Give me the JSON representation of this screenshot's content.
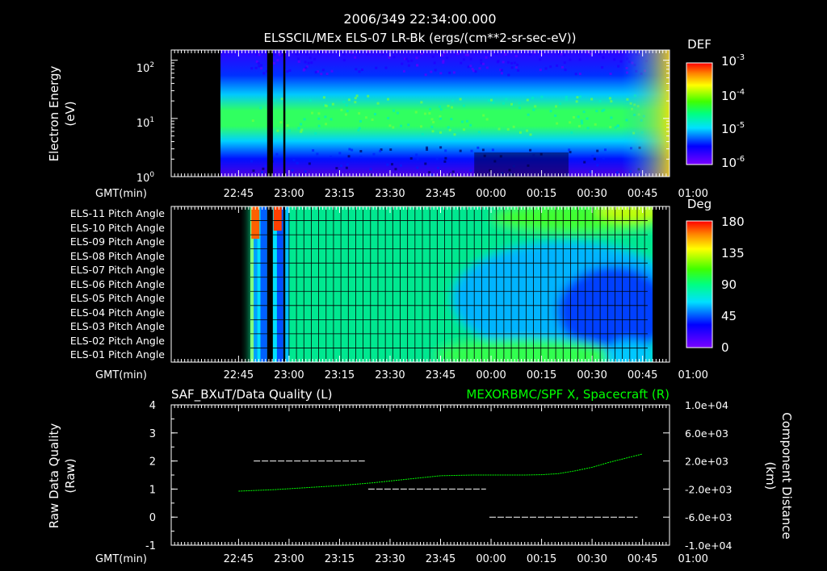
{
  "header": {
    "timestamp": "2006/349 22:34:00.000",
    "subtitle": "ELSSCIL/MEx ELS-07 LR-Bk  (ergs/(cm**2-sr-sec-eV))"
  },
  "time_axis": {
    "label": "GMT(min)",
    "ticks": [
      "22:45",
      "23:00",
      "23:15",
      "23:30",
      "23:45",
      "00:00",
      "00:15",
      "00:30",
      "00:45",
      "01:00"
    ]
  },
  "chart_data": [
    {
      "type": "heatmap",
      "name": "energy-spectrogram",
      "ylabel_line1": "Electron Energy",
      "ylabel_line2": "(eV)",
      "y_scale": "log",
      "ylim": [
        1,
        150
      ],
      "y_ticks": [
        "10",
        "10",
        "10"
      ],
      "y_tick_exponents": [
        "0",
        "1",
        "2"
      ],
      "x_range_min": [
        -20,
        128
      ],
      "x_ticks_min": [
        0,
        15,
        30,
        45,
        60,
        75,
        90,
        105,
        120,
        135
      ],
      "data_start_min": 3.5,
      "gaps_min": [
        [
          8.5,
          10.2
        ],
        [
          13.3,
          13.9
        ]
      ],
      "colorbar": {
        "title": "DEF",
        "labels": [
          "10",
          "10",
          "10",
          "10"
        ],
        "exponents": [
          "-3",
          "-4",
          "-5",
          "-6"
        ],
        "values": [
          0.001,
          0.0001,
          1e-05,
          1e-06
        ]
      }
    },
    {
      "type": "heatmap",
      "name": "pitch-angle",
      "rows": [
        "ELS-11 Pitch Angle",
        "ELS-10 Pitch Angle",
        "ELS-09 Pitch Angle",
        "ELS-08 Pitch Angle",
        "ELS-07 Pitch Angle",
        "ELS-06 Pitch Angle",
        "ELS-05 Pitch Angle",
        "ELS-04 Pitch Angle",
        "ELS-03 Pitch Angle",
        "ELS-02 Pitch Angle",
        "ELS-01 Pitch Angle"
      ],
      "data_start_min": 3.5,
      "data_end_min": 121.5,
      "grid": true,
      "colorbar": {
        "title": "Deg",
        "labels": [
          "180",
          "135",
          "90",
          "45",
          "0"
        ],
        "values": [
          180,
          135,
          90,
          45,
          0
        ]
      }
    },
    {
      "type": "line",
      "name": "quality-and-distance",
      "title_left": "SAF_BXuT/Data Quality (L)",
      "title_right": "MEXORBMC/SPF X, Spacecraft (R)",
      "left_axis": {
        "label_line1": "Raw Data Quality",
        "label_line2": "(Raw)",
        "ylim": [
          -1,
          4
        ],
        "ticks": [
          "-1",
          "0",
          "1",
          "2",
          "3",
          "4"
        ]
      },
      "right_axis": {
        "label_line1": "Component Distance",
        "label_line2": "(km)",
        "ylim": [
          -10000,
          10000
        ],
        "ticks": [
          "1.0e+04",
          "6.0e+03",
          "2.0e+03",
          "-2.0e+03",
          "-6.0e+03",
          "-1.0e+04"
        ],
        "tick_values": [
          10000,
          6000,
          2000,
          -2000,
          -6000,
          -10000
        ]
      },
      "series": [
        {
          "name": "SAF_BXuT/Data Quality (L)",
          "axis": "left",
          "color": "#ffffff",
          "style": "dashed",
          "segments": [
            {
              "x": [
                4.5,
                37.5
              ],
              "y": 2
            },
            {
              "x": [
                38.5,
                73.5
              ],
              "y": 1
            },
            {
              "x": [
                74.5,
                118.5
              ],
              "y": 0
            }
          ]
        },
        {
          "name": "MEXORBMC/SPF X, Spacecraft (R)",
          "axis": "right",
          "color": "#00ff00",
          "x": [
            0,
            10,
            20,
            30,
            40,
            50,
            60,
            70,
            80,
            85,
            90,
            95,
            100,
            105,
            110,
            115,
            120
          ],
          "y": [
            -2300,
            -2100,
            -1800,
            -1500,
            -1100,
            -600,
            -100,
            0,
            0,
            0,
            50,
            200,
            600,
            1100,
            1800,
            2400,
            3000
          ]
        }
      ]
    }
  ]
}
